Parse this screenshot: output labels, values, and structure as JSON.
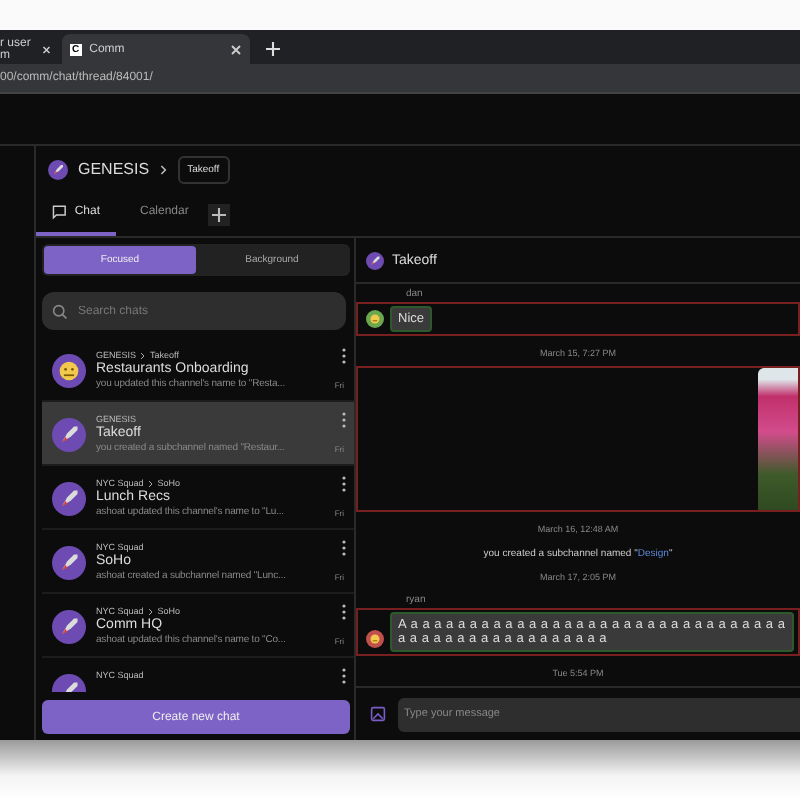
{
  "browser": {
    "tabs": [
      {
        "title": "r user m",
        "selected": false
      },
      {
        "title": "Comm",
        "selected": true,
        "favicon": "C"
      }
    ],
    "address": "00/comm/chat/thread/84001/"
  },
  "header": {
    "community": "GENESIS",
    "thread": "Takeoff"
  },
  "tabs": [
    {
      "label": "Chat",
      "selected": true,
      "kind": "chat"
    },
    {
      "label": "Calendar",
      "selected": false,
      "kind": "calendar"
    }
  ],
  "filter": [
    {
      "label": "Focused",
      "selected": true
    },
    {
      "label": "Background",
      "selected": false
    }
  ],
  "search": {
    "placeholder": "Search chats"
  },
  "chats": [
    {
      "path": [
        "GENESIS",
        "Takeoff"
      ],
      "name": "Restaurants Onboarding",
      "preview": "you updated this channel's name to \"Resta...",
      "time": "Fri",
      "kind": "face",
      "selected": false
    },
    {
      "path": [
        "GENESIS"
      ],
      "name": "Takeoff",
      "preview": "you created a subchannel named \"Restaur...",
      "time": "Fri",
      "kind": "rocket",
      "selected": true
    },
    {
      "path": [
        "NYC Squad",
        "SoHo"
      ],
      "name": "Lunch Recs",
      "preview": "ashoat updated this channel's name to \"Lu...",
      "time": "Fri",
      "kind": "rocket",
      "selected": false
    },
    {
      "path": [
        "NYC Squad"
      ],
      "name": "SoHo",
      "preview": "ashoat created a subchannel named \"Lunc...",
      "time": "Fri",
      "kind": "rocket",
      "selected": false
    },
    {
      "path": [
        "NYC Squad",
        "SoHo"
      ],
      "name": "Comm HQ",
      "preview": "ashoat updated this channel's name to \"Co...",
      "time": "Fri",
      "kind": "rocket",
      "selected": false
    },
    {
      "path": [
        "NYC Squad"
      ],
      "kind": "rocket",
      "selected": false
    }
  ],
  "create_button": "Create new chat",
  "thread": {
    "title": "Takeoff"
  },
  "messages": [
    {
      "kind": "text",
      "author": "dan",
      "text": "Nice",
      "color": "#6aa84f"
    },
    {
      "kind": "time",
      "text": "March 15, 7:27 PM"
    },
    {
      "kind": "image"
    },
    {
      "kind": "time",
      "text": "March 16, 12:48 AM"
    },
    {
      "kind": "system",
      "text": "you created a subchannel named \"",
      "link": "Design",
      "end": "\""
    },
    {
      "kind": "time",
      "text": "March 17, 2:05 PM"
    },
    {
      "kind": "text",
      "author": "ryan",
      "text": "A a a a a a a a a a a a a a a a a a a a a a a a a a a a a a a a a a a a a a a a a a a a a a a a a a a",
      "color": "#c0504d"
    },
    {
      "kind": "time",
      "text": "Tue 5:54 PM"
    }
  ],
  "composer": {
    "placeholder": "Type your message"
  }
}
